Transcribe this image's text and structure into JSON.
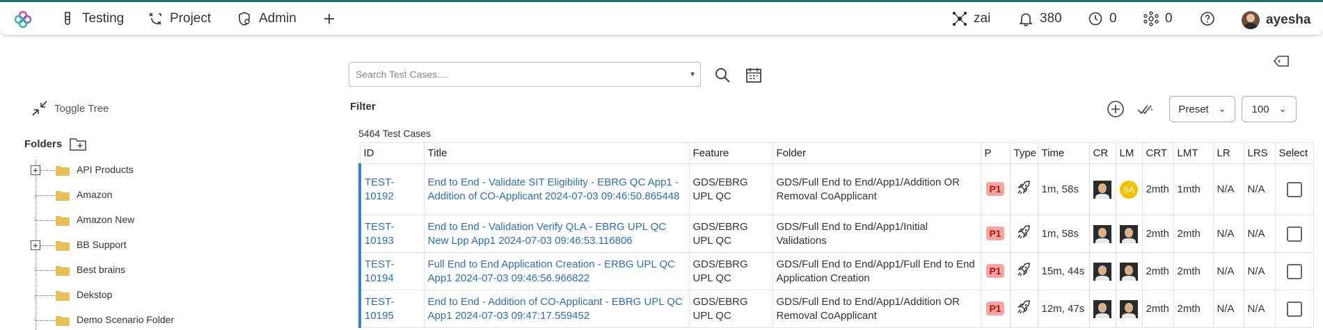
{
  "nav": {
    "items": [
      {
        "label": "Testing",
        "icon": "flask-icon"
      },
      {
        "label": "Project",
        "icon": "project-icon"
      },
      {
        "label": "Admin",
        "icon": "admin-shield-icon"
      }
    ],
    "add_icon": "plus-icon"
  },
  "topright": {
    "workspace": "zai",
    "notifications": "380",
    "pending": "0",
    "network": "0",
    "user": "ayesha"
  },
  "sidebar": {
    "toggle_tree": "Toggle Tree",
    "folders_title": "Folders",
    "folders": [
      {
        "label": "API Products",
        "expandable": true
      },
      {
        "label": "Amazon",
        "expandable": false
      },
      {
        "label": "Amazon New",
        "expandable": false
      },
      {
        "label": "BB Support",
        "expandable": true
      },
      {
        "label": "Best brains",
        "expandable": false
      },
      {
        "label": "Dekstop",
        "expandable": false
      },
      {
        "label": "Demo Scenario Folder",
        "expandable": false
      }
    ]
  },
  "search": {
    "placeholder": "Search Test Cases...."
  },
  "filter": {
    "label": "Filter"
  },
  "count": "5464 Test Cases",
  "controls": {
    "preset": "Preset",
    "page_size": "100"
  },
  "colors": {
    "accent": "#2f80d6",
    "priority_bg": "#f8a4a4",
    "lm_badge": "#f2c200"
  },
  "table": {
    "headers": [
      "ID",
      "Title",
      "Feature",
      "Folder",
      "P",
      "Type",
      "Time",
      "CR",
      "LM",
      "CRT",
      "LMT",
      "LR",
      "LRS",
      "Select"
    ],
    "rows": [
      {
        "id": "TEST-10192",
        "title": "End to End - Validate SIT Eligibility - EBRG QC App1 - Addition of CO-Applicant 2024-07-03 09:46:50.865448",
        "feature": "GDS/EBRG UPL QC",
        "folder": "GDS/Full End to End/App1/Addition OR Removal CoApplicant",
        "p": "P1",
        "time": "1m, 58s",
        "lm": "SA",
        "crt": "2mth",
        "lmt": "1mth",
        "lr": "N/A",
        "lrs": "N/A"
      },
      {
        "id": "TEST-10193",
        "title": "End to End - Validation Verify QLA - EBRG UPL QC New Lpp App1 2024-07-03 09:46:53.116806",
        "feature": "GDS/EBRG UPL QC",
        "folder": "GDS/Full End to End/App1/Initial Validations",
        "p": "P1",
        "time": "1m, 58s",
        "lm": "",
        "crt": "2mth",
        "lmt": "2mth",
        "lr": "N/A",
        "lrs": "N/A"
      },
      {
        "id": "TEST-10194",
        "title": "Full End to End Application Creation - ERBG UPL QC App1 2024-07-03 09:46:56.966822",
        "feature": "GDS/EBRG UPL QC",
        "folder": "GDS/Full End to End/App1/Full End to End Application Creation",
        "p": "P1",
        "time": "15m, 44s",
        "lm": "",
        "crt": "2mth",
        "lmt": "2mth",
        "lr": "N/A",
        "lrs": "N/A"
      },
      {
        "id": "TEST-10195",
        "title": "End to End - Addition of CO-Applicant - EBRG UPL QC App1 2024-07-03 09:47:17.559452",
        "feature": "GDS/EBRG UPL QC",
        "folder": "GDS/Full End to End/App1/Addition OR Removal CoApplicant",
        "p": "P1",
        "time": "12m, 47s",
        "lm": "",
        "crt": "2mth",
        "lmt": "2mth",
        "lr": "N/A",
        "lrs": "N/A"
      }
    ]
  }
}
